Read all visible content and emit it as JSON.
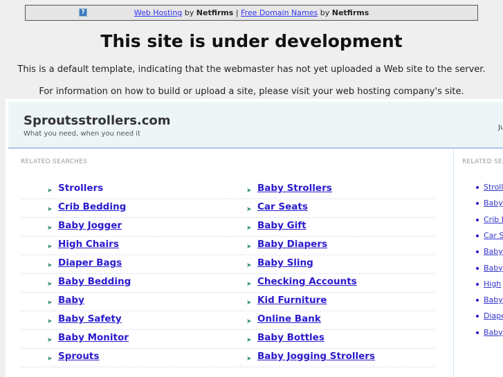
{
  "topbar": {
    "link1": "Web Hosting",
    "by1": "by",
    "brand1": "Netfirms",
    "sep": "|",
    "link2": "Free Domain Names",
    "by2": "by",
    "brand2": "Netfirms",
    "help_icon": "?"
  },
  "title": "This site is under development",
  "message1": "This is a default template, indicating that the webmaster has not yet uploaded a Web site to the server.",
  "message2": "For information on how to build or upload a site, please visit your web hosting company's site.",
  "header": {
    "site_name": "Sproutsstrollers.com",
    "tagline": "What you need, when you need it",
    "right_text": "Ju"
  },
  "left": {
    "label": "RELATED SEARCHES",
    "col1": [
      "Strollers",
      "Crib Bedding",
      "Baby Jogger",
      "High Chairs",
      "Diaper Bags",
      "Baby Bedding",
      "Baby",
      "Baby Safety",
      "Baby Monitor",
      "Sprouts"
    ],
    "col2": [
      "Baby Strollers",
      "Car Seats",
      "Baby Gift",
      "Baby Diapers",
      "Baby Sling",
      "Checking Accounts",
      "Kid Furniture",
      "Online Bank",
      "Baby Bottles",
      "Baby Jogging Strollers"
    ]
  },
  "right": {
    "label": "RELATED SEA",
    "items": [
      "Stroll",
      "Baby",
      "Crib B",
      "Car S",
      "Baby",
      "Baby",
      "High",
      "Baby",
      "Diape",
      "Baby"
    ]
  }
}
